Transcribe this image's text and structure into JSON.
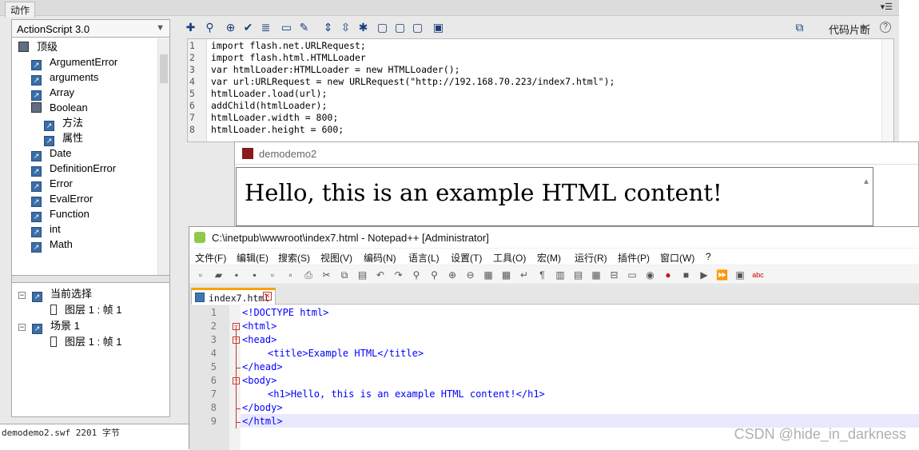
{
  "flash": {
    "panel_tab": "动作",
    "panel_menu": "▾☰",
    "language_select": "ActionScript 3.0",
    "tree": [
      {
        "label": "顶级",
        "kind": "book",
        "indent": 0
      },
      {
        "label": "ArgumentError",
        "kind": "class",
        "indent": 1
      },
      {
        "label": "arguments",
        "kind": "class",
        "indent": 1
      },
      {
        "label": "Array",
        "kind": "class",
        "indent": 1
      },
      {
        "label": "Boolean",
        "kind": "book",
        "indent": 1
      },
      {
        "label": "方法",
        "kind": "class",
        "indent": 2
      },
      {
        "label": "属性",
        "kind": "class",
        "indent": 2
      },
      {
        "label": "Date",
        "kind": "class",
        "indent": 1
      },
      {
        "label": "DefinitionError",
        "kind": "class",
        "indent": 1
      },
      {
        "label": "Error",
        "kind": "class",
        "indent": 1
      },
      {
        "label": "EvalError",
        "kind": "class",
        "indent": 1
      },
      {
        "label": "Function",
        "kind": "class",
        "indent": 1
      },
      {
        "label": "int",
        "kind": "class",
        "indent": 1
      },
      {
        "label": "Math",
        "kind": "class",
        "indent": 1
      }
    ],
    "scene_tree": [
      {
        "label": "当前选择",
        "indent": 0,
        "expander": "−"
      },
      {
        "label": "图层 1 : 帧 1",
        "indent": 1,
        "expander": ""
      },
      {
        "label": "场景 1",
        "indent": 0,
        "expander": "−"
      },
      {
        "label": "图层 1 : 帧 1",
        "indent": 1,
        "expander": ""
      }
    ],
    "toolbar_snippets": "代码片断",
    "help": "?",
    "code_lines": [
      {
        "n": "1",
        "text": "import flash.net.URLRequest;"
      },
      {
        "n": "2",
        "text": "import flash.html.HTMLLoader"
      },
      {
        "n": "3",
        "text": "var htmlLoader:HTMLLoader = new HTMLLoader();"
      },
      {
        "n": "4",
        "text": "var url:URLRequest = new URLRequest(\"http://192.168.70.223/index7.html\");"
      },
      {
        "n": "5",
        "text": "htmlLoader.load(url);"
      },
      {
        "n": "6",
        "text": "addChild(htmlLoader);"
      },
      {
        "n": "7",
        "text": "htmlLoader.width = 800;"
      },
      {
        "n": "8",
        "text": "htmlLoader.height = 600;"
      }
    ],
    "lower_strip_text": "demodemo2.swf    2201 字节"
  },
  "demo_window": {
    "title": "demodemo2",
    "heading": "Hello, this is an example HTML content!"
  },
  "notepad": {
    "title": "C:\\inetpub\\wwwroot\\index7.html - Notepad++ [Administrator]",
    "menu": [
      "文件(F)",
      "编辑(E)",
      "搜索(S)",
      "视图(V)",
      "编码(N)",
      "语言(L)",
      "设置(T)",
      "工具(O)",
      "宏(M)",
      "运行(R)",
      "插件(P)",
      "窗口(W)",
      "?"
    ],
    "tab_name": "index7.html",
    "lines": [
      {
        "n": "1",
        "text": "<!DOCTYPE html>"
      },
      {
        "n": "2",
        "text": "<html>"
      },
      {
        "n": "3",
        "text": "<head>"
      },
      {
        "n": "4",
        "text": "<title>Example HTML</title>"
      },
      {
        "n": "5",
        "text": "</head>"
      },
      {
        "n": "6",
        "text": "<body>"
      },
      {
        "n": "7",
        "text": "<h1>Hello, this is an example HTML content!</h1>"
      },
      {
        "n": "8",
        "text": "</body>"
      },
      {
        "n": "9",
        "text": "</html>"
      }
    ]
  },
  "watermark": "CSDN @hide_in_darkness"
}
